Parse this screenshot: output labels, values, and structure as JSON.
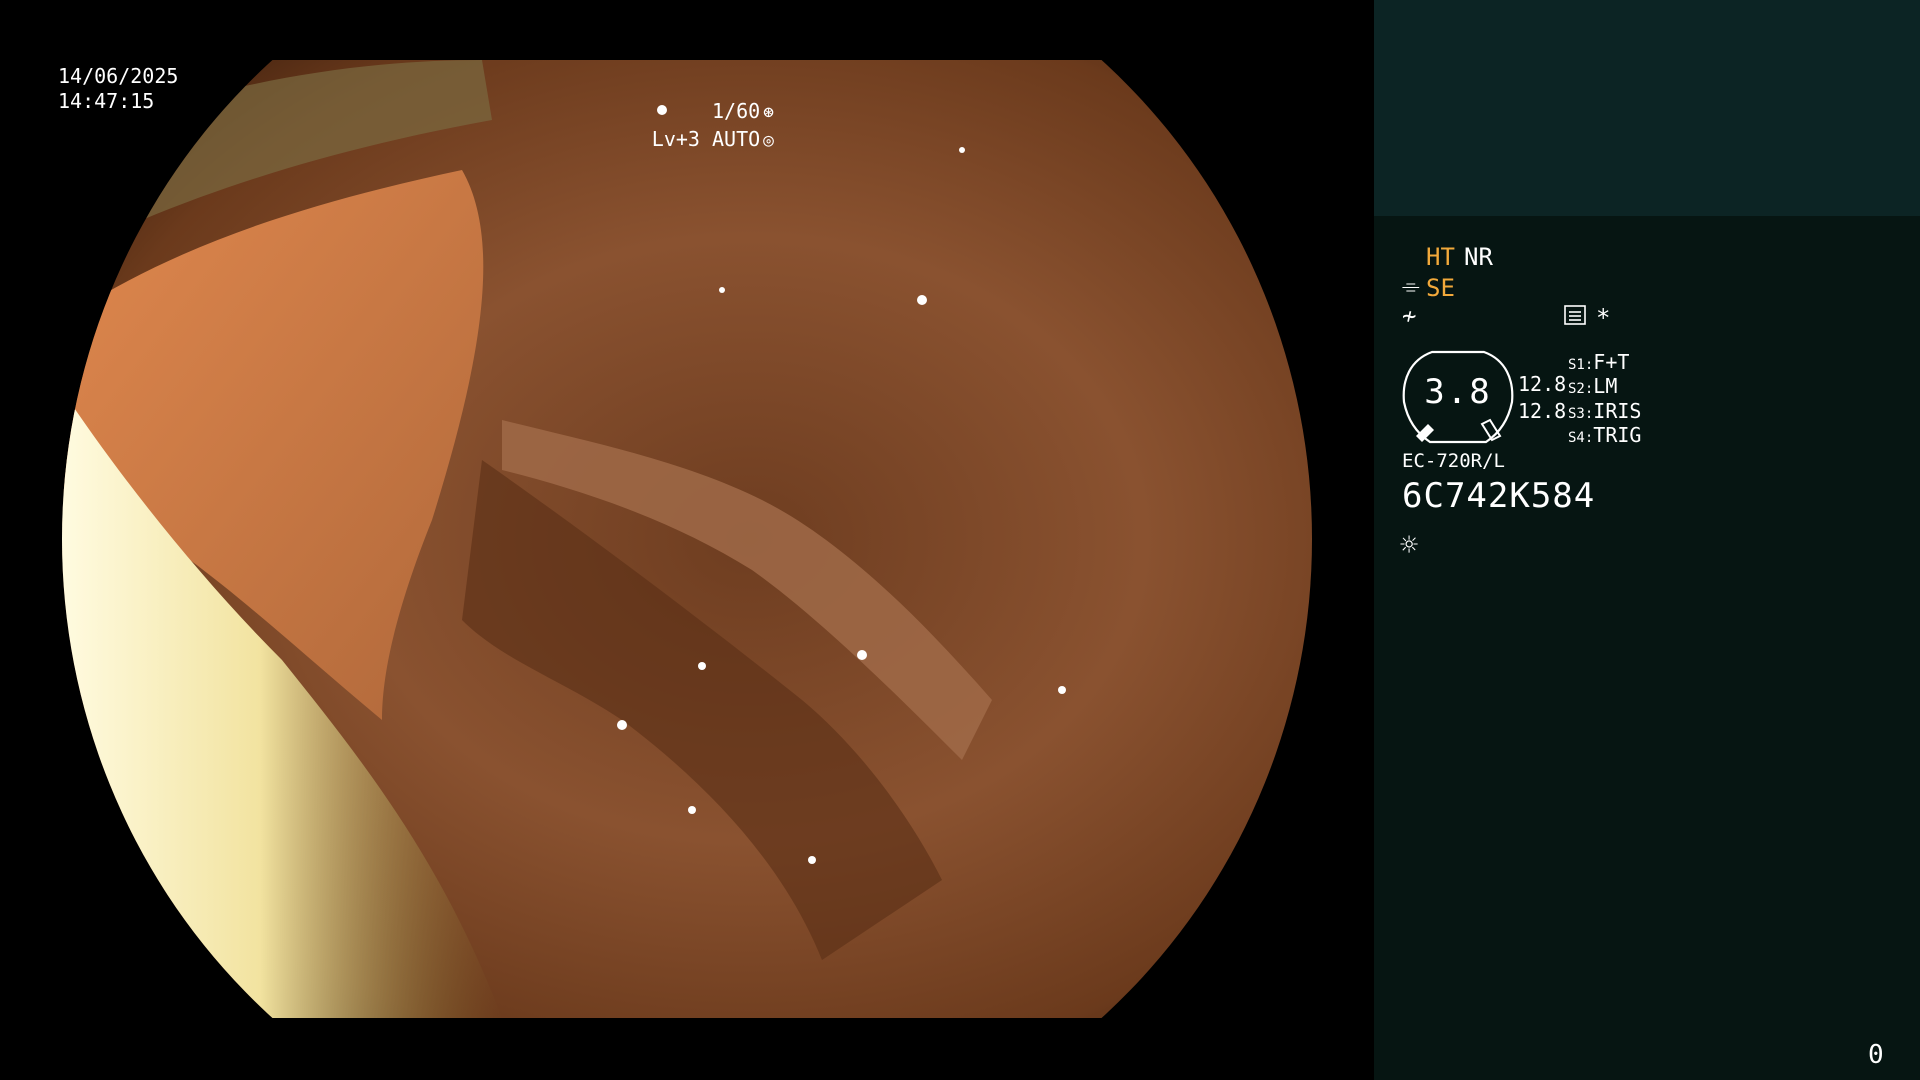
{
  "video": {
    "date": "14/06/2025",
    "time": "14:47:15",
    "shutter": "1/60",
    "shutter_icon": "aperture-icon",
    "level": "Lv+3 AUTO",
    "level_icon": "auto-exposure-icon"
  },
  "panel": {
    "ht": "HT",
    "nr": "NR",
    "se": "SE",
    "se_icon": "scope-icon",
    "wave_icon": "wave-icon",
    "menu_icon": "menu-icon",
    "star": "*",
    "dial_value": "3.8",
    "num1": "12.8",
    "num2": "12.8",
    "switches": [
      {
        "key": "S1:",
        "value": "F+T"
      },
      {
        "key": "S2:",
        "value": "LM"
      },
      {
        "key": "S3:",
        "value": "IRIS"
      },
      {
        "key": "S4:",
        "value": "TRIG"
      }
    ],
    "model": "EC-720R/L",
    "serial": "6C742K584",
    "light_icon": "sun-icon",
    "page_number": "0"
  },
  "colors": {
    "panel_bg": "#061512",
    "panel_top_bg": "#0c2424",
    "accent_orange": "#f2a93b"
  }
}
